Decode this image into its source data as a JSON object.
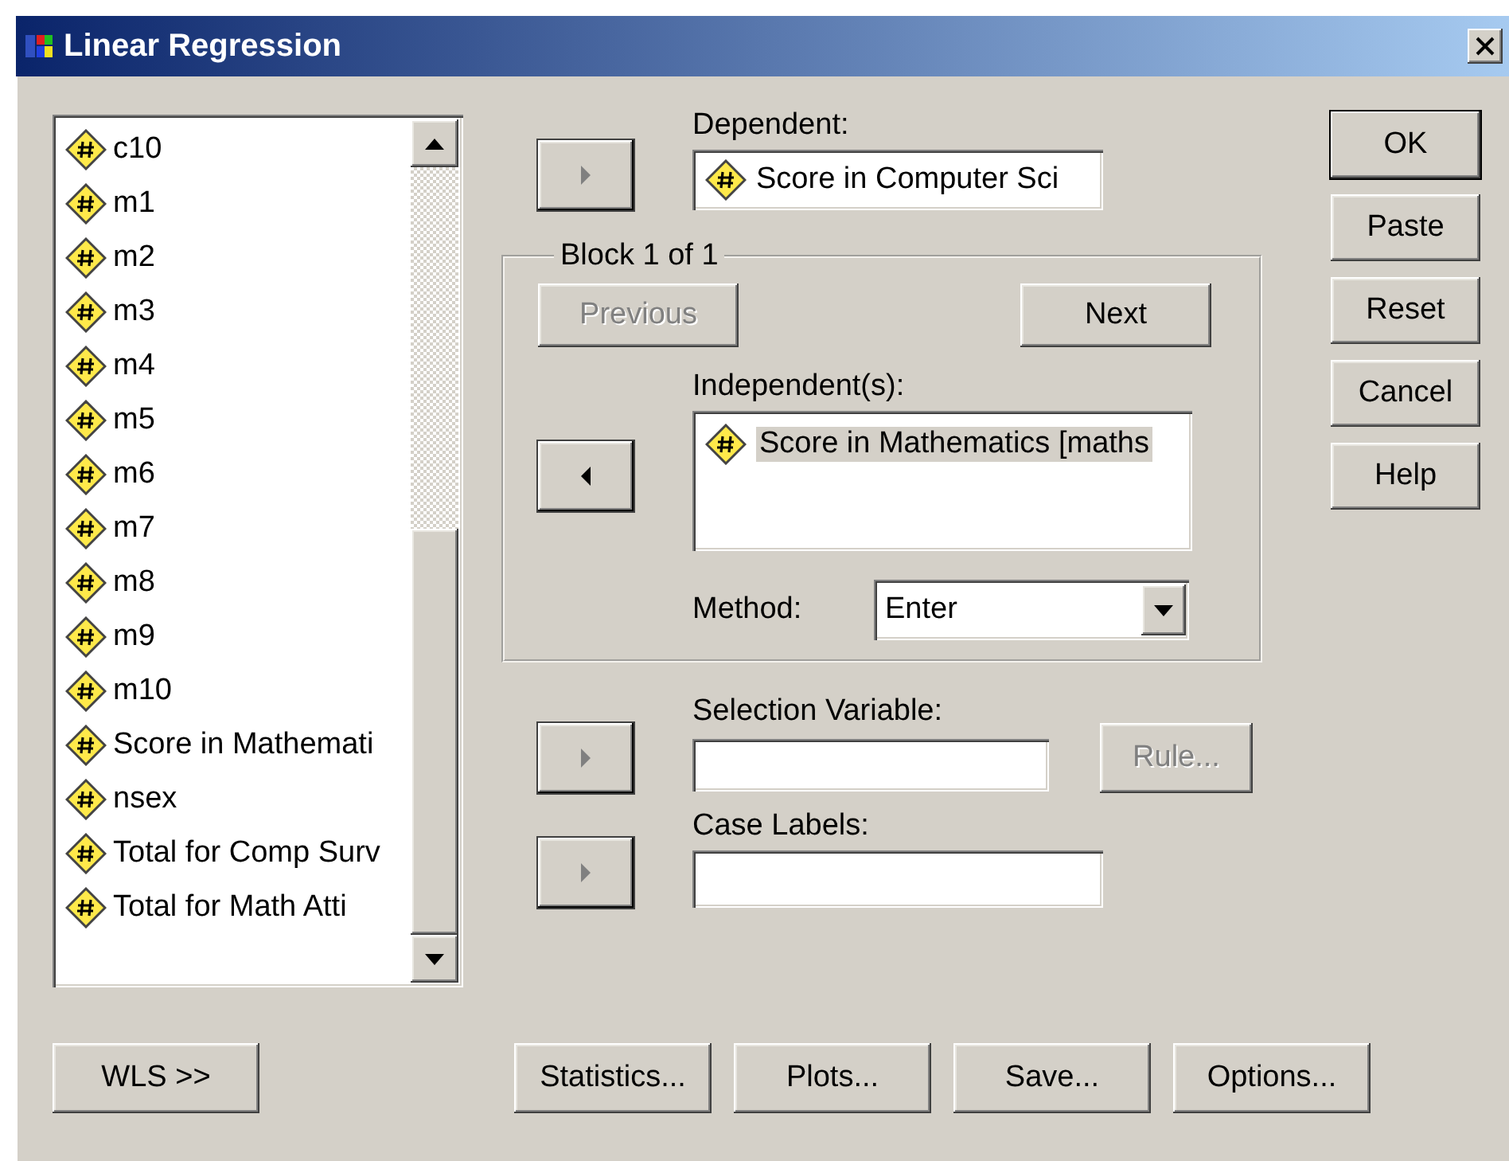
{
  "window": {
    "title": "Linear Regression"
  },
  "variables": [
    "c10",
    "m1",
    "m2",
    "m3",
    "m4",
    "m5",
    "m6",
    "m7",
    "m8",
    "m9",
    "m10",
    "Score in Mathemati",
    "nsex",
    "Total for Comp Surv",
    "Total for Math Atti"
  ],
  "dependent": {
    "label": "Dependent:",
    "value": "Score in Computer Sci",
    "arrow": {
      "pointing_left": false,
      "disabled": true
    }
  },
  "block": {
    "title": "Block 1 of 1",
    "buttons": [
      {
        "label": "Previous",
        "disabled": true
      },
      {
        "label": "Next",
        "disabled": false
      }
    ],
    "independents_label": "Independent(s):",
    "independents": [
      {
        "name": "Score in Mathematics [maths",
        "selected": true
      }
    ],
    "arrow": {
      "pointing_left": true,
      "disabled": false
    },
    "method": {
      "label": "Method:",
      "value": "Enter"
    }
  },
  "selection_variable": {
    "label": "Selection Variable:",
    "arrow": {
      "pointing_left": false,
      "disabled": true
    },
    "rule_button": {
      "label": "Rule...",
      "disabled": true
    }
  },
  "case_labels": {
    "label": "Case Labels:",
    "arrow": {
      "pointing_left": false,
      "disabled": true
    }
  },
  "side_buttons": [
    {
      "label": "OK",
      "default": true
    },
    {
      "label": "Paste",
      "default": false
    },
    {
      "label": "Reset",
      "default": false
    },
    {
      "label": "Cancel",
      "default": false
    },
    {
      "label": "Help",
      "default": false
    }
  ],
  "bottom_buttons": [
    "WLS >>",
    "Statistics...",
    "Plots...",
    "Save...",
    "Options..."
  ]
}
